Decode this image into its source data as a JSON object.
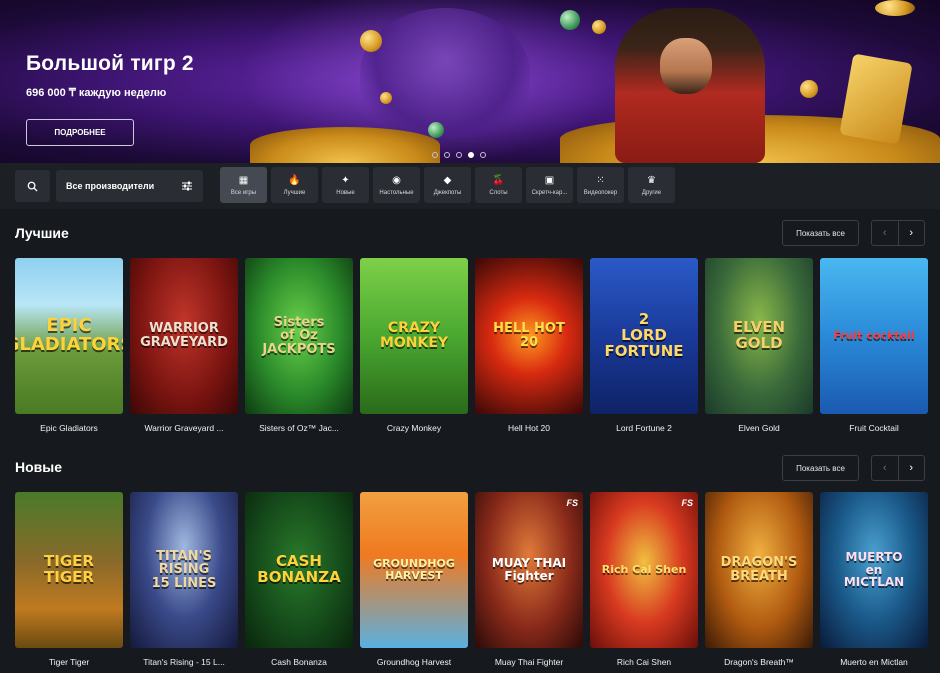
{
  "banner": {
    "title": "Большой тигр 2",
    "subtitle": "696 000 ₸ каждую неделю",
    "button_label": "ПОДРОБНЕЕ",
    "slide_count": 5,
    "active_slide": 4
  },
  "filters": {
    "search_icon": "search-icon",
    "providers_label": "Все производители",
    "providers_icon": "sliders-icon",
    "categories": [
      {
        "label": "Все игры",
        "icon": "grid-icon",
        "glyph": "▦",
        "active": true
      },
      {
        "label": "Лучшие",
        "icon": "flame-icon",
        "glyph": "🔥",
        "active": false
      },
      {
        "label": "Новые",
        "icon": "new-badge-icon",
        "glyph": "✦",
        "active": false
      },
      {
        "label": "Настольные",
        "icon": "chip-icon",
        "glyph": "◉",
        "active": false
      },
      {
        "label": "Джекпоты",
        "icon": "diamond-icon",
        "glyph": "◆",
        "active": false
      },
      {
        "label": "Слоты",
        "icon": "cherries-icon",
        "glyph": "🍒",
        "active": false
      },
      {
        "label": "Скретч-кар...",
        "icon": "scratch-card-icon",
        "glyph": "▣",
        "active": false
      },
      {
        "label": "Видеопокер",
        "icon": "dice-icon",
        "glyph": "⁙",
        "active": false
      },
      {
        "label": "Другие",
        "icon": "crown-icon",
        "glyph": "♛",
        "active": false
      }
    ]
  },
  "sections": [
    {
      "title": "Лучшие",
      "show_all_label": "Показать все",
      "games": [
        {
          "name": "Epic Gladiators",
          "art": "EPIC\nGLADIATORS"
        },
        {
          "name": "Warrior Graveyard ...",
          "art": "WARRIOR\nGRAVEYARD"
        },
        {
          "name": "Sisters of Oz™ Jac...",
          "art": "Sisters\nof Oz\nJACKPOTS"
        },
        {
          "name": "Crazy Monkey",
          "art": "CRAZY\nMONKEY"
        },
        {
          "name": "Hell Hot 20",
          "art": "HELL HOT\n20"
        },
        {
          "name": "Lord Fortune 2",
          "art": "2\nLORD\nFORTUNE"
        },
        {
          "name": "Elven Gold",
          "art": "ELVEN\nGOLD"
        },
        {
          "name": "Fruit Cocktail",
          "art": "Fruit cocktail"
        }
      ]
    },
    {
      "title": "Новые",
      "show_all_label": "Показать все",
      "games": [
        {
          "name": "Tiger Tiger",
          "art": "TIGER\nTIGER"
        },
        {
          "name": "Titan's Rising - 15 L...",
          "art": "TITAN'S\nRISING\n15 LINES"
        },
        {
          "name": "Cash Bonanza",
          "art": "CASH\nBONANZA"
        },
        {
          "name": "Groundhog Harvest",
          "art": "GROUNDHOG\nHARVEST"
        },
        {
          "name": "Muay Thai Fighter",
          "art": "MUAY THAI\nFighter",
          "badge": "FS"
        },
        {
          "name": "Rich Cai Shen",
          "art": "Rich Cai Shen",
          "badge": "FS"
        },
        {
          "name": "Dragon's Breath™",
          "art": "DRAGON'S\nBREATH"
        },
        {
          "name": "Muerto en Mictlan",
          "art": "MUERTO\nen\nMICTLAN"
        }
      ]
    }
  ],
  "colors": {
    "page_bg": "#16191d",
    "bar_bg": "#1c1f24",
    "tile_bg": "#2a2e34",
    "tile_active": "#454a52"
  }
}
